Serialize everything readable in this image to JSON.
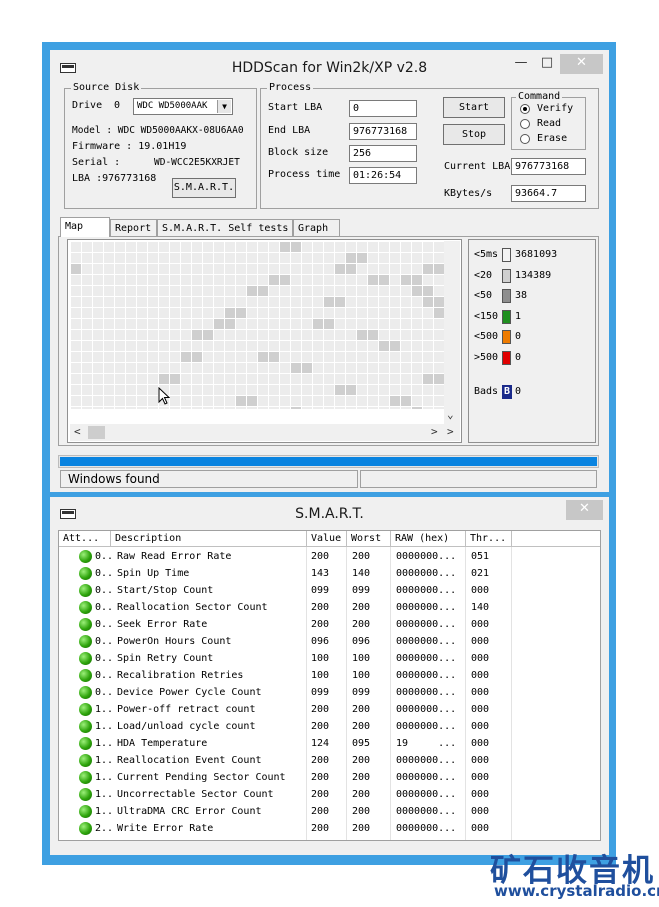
{
  "main_window": {
    "title": "HDDScan for Win2k/XP  v2.8",
    "source_disk": {
      "group_label": "Source Disk",
      "drive_label": "Drive",
      "drive_index": "0",
      "drive_select": "WDC WD5000AAK",
      "model": "Model : WDC WD5000AAKX-08U6AA0",
      "firmware": "Firmware : 19.01H19",
      "serial_label": "Serial :",
      "serial_value": "WD-WCC2E5KXRJET",
      "lba": "LBA :976773168",
      "smart_button": "S.M.A.R.T."
    },
    "process": {
      "group_label": "Process",
      "start_lba_label": "Start LBA",
      "start_lba": "0",
      "end_lba_label": "End LBA",
      "end_lba": "976773168",
      "block_size_label": "Block size",
      "block_size": "256",
      "process_time_label": "Process time",
      "process_time": "01:26:54",
      "start_button": "Start",
      "stop_button": "Stop",
      "current_lba_label": "Current LBA",
      "current_lba": "976773168",
      "kbytes_label": "KBytes/s",
      "kbytes": "93664.7"
    },
    "command": {
      "group_label": "Command",
      "options": [
        "Verify",
        "Read",
        "Erase"
      ],
      "selected": "Verify"
    },
    "tabs": [
      "Map",
      "Report",
      "S.M.A.R.T. Self tests",
      "Graph"
    ],
    "active_tab": "Map",
    "legend": [
      {
        "label": "<5ms",
        "count": "3681093",
        "color": "#f4f4f4"
      },
      {
        "label": "<20",
        "count": "134389",
        "color": "#cfcfcf"
      },
      {
        "label": "<50",
        "count": "38",
        "color": "#8e8e8e"
      },
      {
        "label": "<150",
        "count": "1",
        "color": "#1f8f1f"
      },
      {
        "label": "<500",
        "count": "0",
        "color": "#ee7b00"
      },
      {
        "label": ">500",
        "count": "0",
        "color": "#e00000"
      }
    ],
    "bads": {
      "label": "Bads",
      "glyph": "B",
      "count": "0",
      "color": "#1a2a8a"
    },
    "progress_percent": 100,
    "status_text": "Windows found",
    "accent_color": "#3ea0e2"
  },
  "smart_window": {
    "title": "S.M.A.R.T.",
    "columns": [
      "Att...",
      "Description",
      "Value",
      "Worst",
      "RAW (hex)",
      "Thr..."
    ],
    "rows": [
      {
        "id": "0...",
        "desc": "Raw Read Error Rate",
        "value": "200",
        "worst": "200",
        "raw": "0000000...",
        "thr": "051"
      },
      {
        "id": "0...",
        "desc": "Spin Up Time",
        "value": "143",
        "worst": "140",
        "raw": "0000000...",
        "thr": "021"
      },
      {
        "id": "0...",
        "desc": "Start/Stop Count",
        "value": "099",
        "worst": "099",
        "raw": "0000000...",
        "thr": "000"
      },
      {
        "id": "0...",
        "desc": "Reallocation Sector Count",
        "value": "200",
        "worst": "200",
        "raw": "0000000...",
        "thr": "140"
      },
      {
        "id": "0...",
        "desc": "Seek Error Rate",
        "value": "200",
        "worst": "200",
        "raw": "0000000...",
        "thr": "000"
      },
      {
        "id": "0...",
        "desc": "PowerOn Hours Count",
        "value": "096",
        "worst": "096",
        "raw": "0000000...",
        "thr": "000"
      },
      {
        "id": "0...",
        "desc": "Spin Retry Count",
        "value": "100",
        "worst": "100",
        "raw": "0000000...",
        "thr": "000"
      },
      {
        "id": "0...",
        "desc": "Recalibration Retries",
        "value": "100",
        "worst": "100",
        "raw": "0000000...",
        "thr": "000"
      },
      {
        "id": "0...",
        "desc": "Device Power Cycle Count",
        "value": "099",
        "worst": "099",
        "raw": "0000000...",
        "thr": "000"
      },
      {
        "id": "1...",
        "desc": "Power-off retract count",
        "value": "200",
        "worst": "200",
        "raw": "0000000...",
        "thr": "000"
      },
      {
        "id": "1...",
        "desc": "Load/unload cycle count",
        "value": "200",
        "worst": "200",
        "raw": "0000000...",
        "thr": "000"
      },
      {
        "id": "1...",
        "desc": "HDA Temperature",
        "value": "124",
        "worst": "095",
        "raw": "19     ...",
        "thr": "000"
      },
      {
        "id": "1...",
        "desc": "Reallocation Event Count",
        "value": "200",
        "worst": "200",
        "raw": "0000000...",
        "thr": "000"
      },
      {
        "id": "1...",
        "desc": "Current Pending Sector Count",
        "value": "200",
        "worst": "200",
        "raw": "0000000...",
        "thr": "000"
      },
      {
        "id": "1...",
        "desc": "Uncorrectable Sector Count",
        "value": "200",
        "worst": "200",
        "raw": "0000000...",
        "thr": "000"
      },
      {
        "id": "1...",
        "desc": "UltraDMA CRC Error Count",
        "value": "200",
        "worst": "200",
        "raw": "0000000...",
        "thr": "000"
      },
      {
        "id": "2...",
        "desc": "Write Error Rate",
        "value": "200",
        "worst": "200",
        "raw": "0000000...",
        "thr": "000"
      }
    ]
  },
  "watermark": {
    "brand": "矿石收音机",
    "url": "www.crystalradio.cn"
  },
  "icons": [
    "system-menu-icon",
    "minimize-icon",
    "maximize-icon",
    "close-icon",
    "dropdown-arrow-icon",
    "scroll-left-icon",
    "scroll-right-icon",
    "scroll-down-icon",
    "status-ok-icon",
    "mouse-cursor-icon"
  ]
}
